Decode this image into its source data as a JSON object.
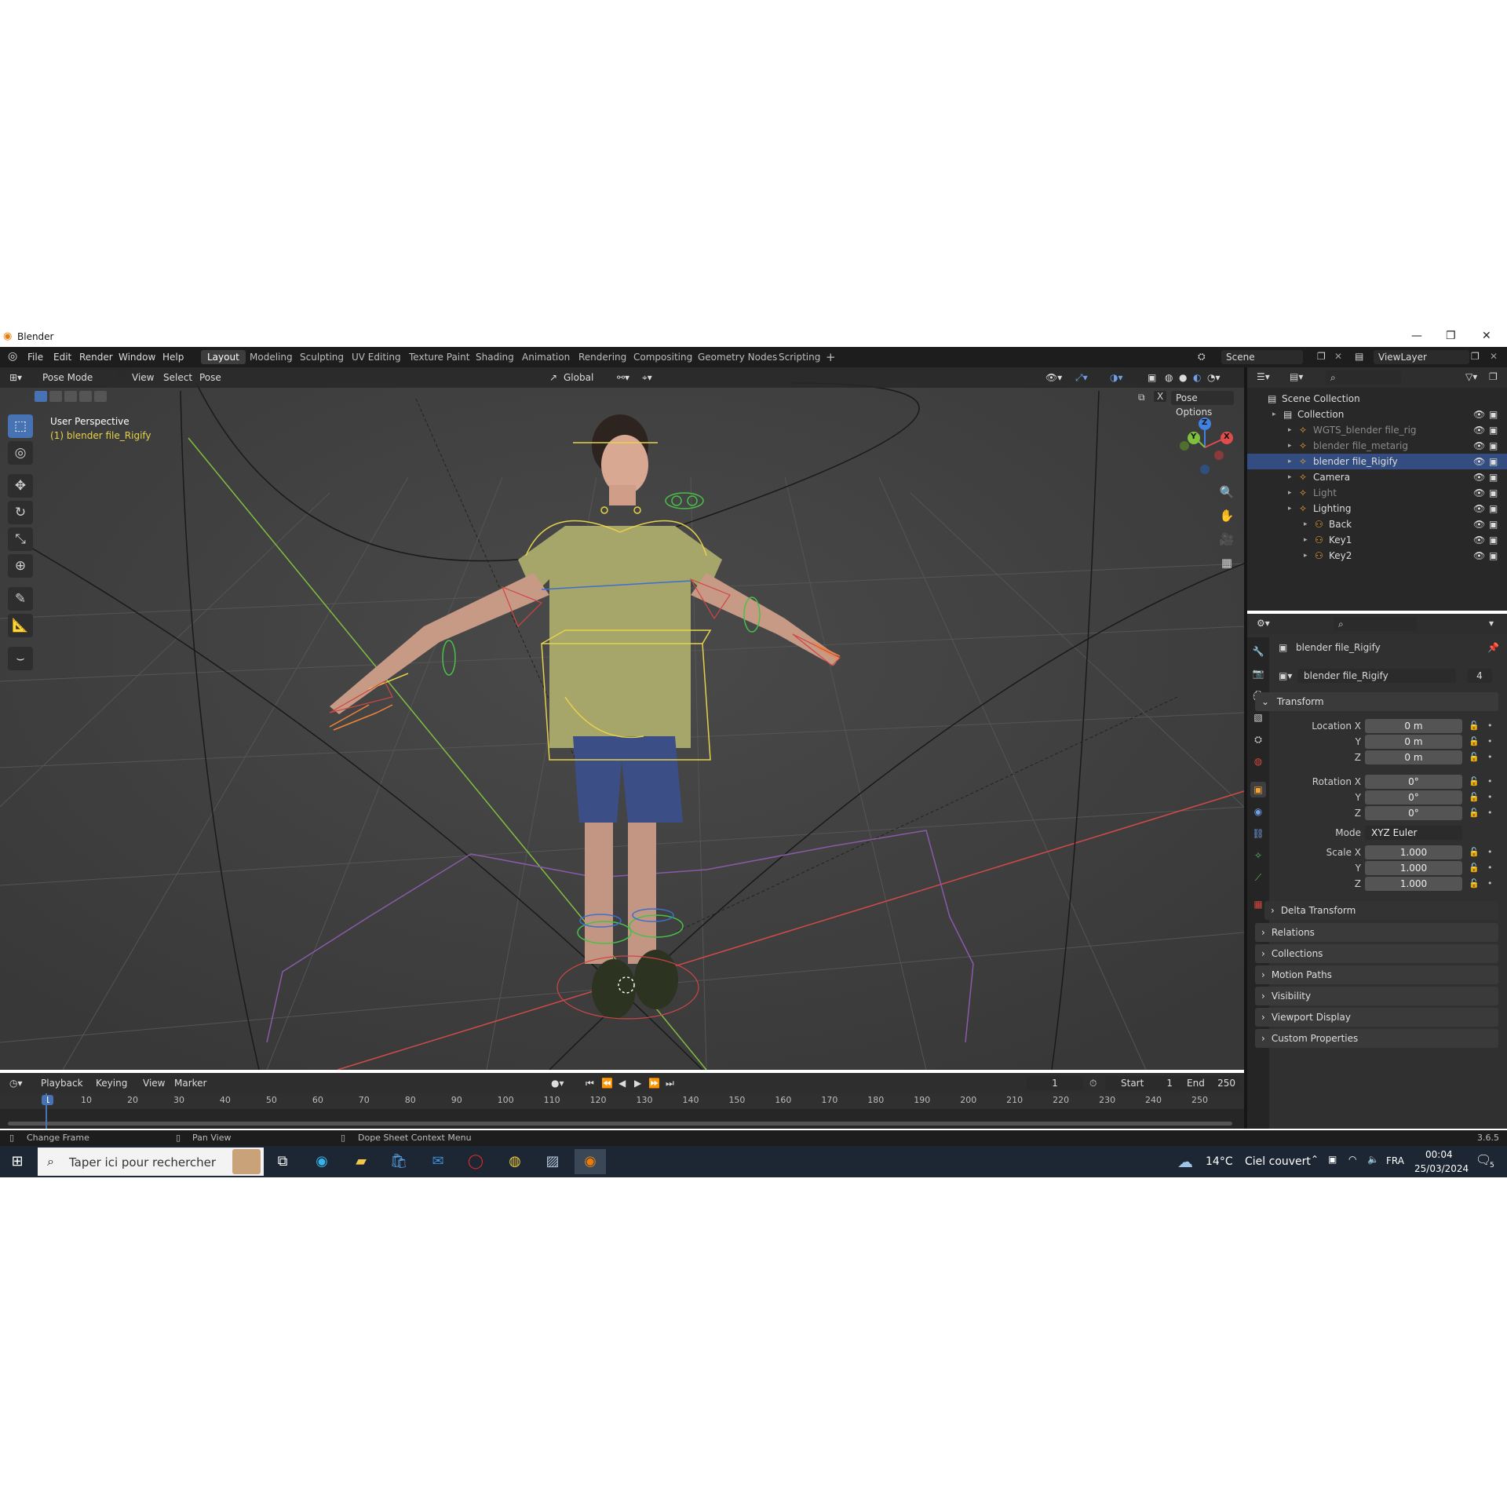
{
  "app": {
    "window_title": "Blender"
  },
  "menu": [
    "File",
    "Edit",
    "Render",
    "Window",
    "Help"
  ],
  "workspace_tabs": [
    "Layout",
    "Modeling",
    "Sculpting",
    "UV Editing",
    "Texture Paint",
    "Shading",
    "Animation",
    "Rendering",
    "Compositing",
    "Geometry Nodes",
    "Scripting"
  ],
  "active_workspace": "Layout",
  "scene": "Scene",
  "view_layer": "ViewLayer",
  "viewport": {
    "mode": "Pose Mode",
    "header_menus": [
      "View",
      "Select",
      "Pose"
    ],
    "orientation": "Global",
    "pose_options": "Pose Options",
    "overlay_title": "User Perspective",
    "overlay_object": "(1) blender file_Rigify",
    "gizmo_axes": [
      "Z",
      "Y",
      "X"
    ]
  },
  "outliner": {
    "items": [
      {
        "label": "Scene Collection",
        "depth": 0
      },
      {
        "label": "Collection",
        "depth": 1
      },
      {
        "label": "WGTS_blender file_rig",
        "depth": 2,
        "dim": true
      },
      {
        "label": "blender file_metarig",
        "depth": 2,
        "dim": true
      },
      {
        "label": "blender file_Rigify",
        "depth": 2,
        "selected": true
      },
      {
        "label": "Camera",
        "depth": 2
      },
      {
        "label": "Light",
        "depth": 2,
        "dim": true
      },
      {
        "label": "Lighting",
        "depth": 2
      },
      {
        "label": "Back",
        "depth": 3
      },
      {
        "label": "Key1",
        "depth": 3
      },
      {
        "label": "Key2",
        "depth": 3
      }
    ]
  },
  "properties": {
    "object_name": "blender file_Rigify",
    "data_name": "blender file_Rigify",
    "user_count": "4",
    "transform_header": "Transform",
    "location_label": "Location X",
    "location": [
      "0 m",
      "0 m",
      "0 m"
    ],
    "rotation_label": "Rotation X",
    "rotation": [
      "0°",
      "0°",
      "0°"
    ],
    "mode_label": "Mode",
    "mode_value": "XYZ Euler",
    "scale_label": "Scale X",
    "scale": [
      "1.000",
      "1.000",
      "1.000"
    ],
    "axis_y": "Y",
    "axis_z": "Z",
    "subpanels": [
      "Delta Transform",
      "Relations",
      "Collections",
      "Motion Paths",
      "Visibility",
      "Viewport Display",
      "Custom Properties"
    ]
  },
  "timeline": {
    "menus": [
      "Playback",
      "Keying",
      "View",
      "Marker"
    ],
    "current_frame": "1",
    "start_label": "Start",
    "start": "1",
    "end_label": "End",
    "end": "250",
    "ruler": [
      "1",
      "10",
      "20",
      "30",
      "40",
      "50",
      "60",
      "70",
      "80",
      "90",
      "100",
      "110",
      "120",
      "130",
      "140",
      "150",
      "160",
      "170",
      "180",
      "190",
      "200",
      "210",
      "220",
      "230",
      "240",
      "250"
    ]
  },
  "statusbar": {
    "left": "Change Frame",
    "middle": "Pan View",
    "right": "Dope Sheet Context Menu",
    "version": "3.6.5"
  },
  "taskbar": {
    "search_placeholder": "Taper ici pour rechercher",
    "weather_temp": "14°C",
    "weather_text": "Ciel couvert",
    "language": "FRA",
    "time": "00:04",
    "date": "25/03/2024",
    "notification_count": "5"
  },
  "colors": {
    "accent": "#4772b3",
    "selection": "#334d80",
    "axis_x": "#e04b4b",
    "axis_y": "#7fbf3f",
    "axis_z": "#3f82e0",
    "bone_yellow": "#e6d24a"
  }
}
